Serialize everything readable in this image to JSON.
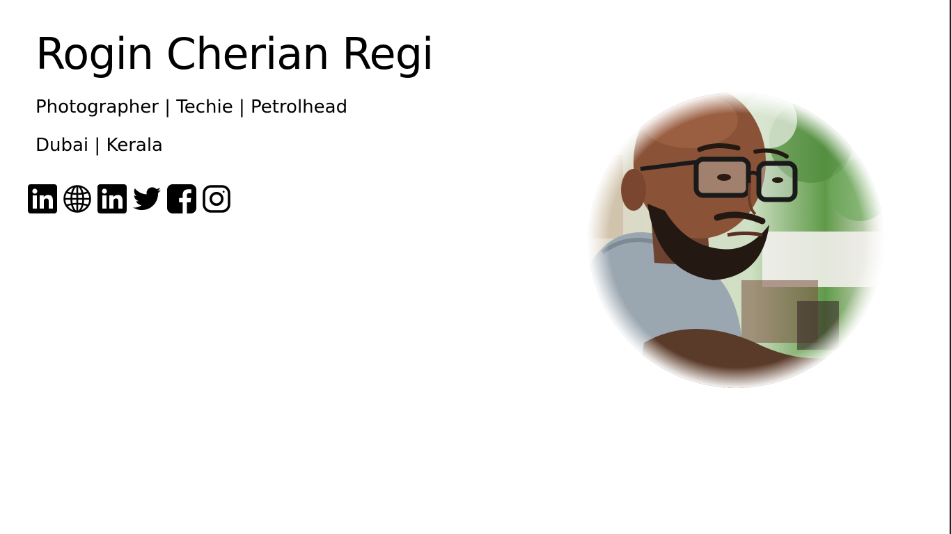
{
  "profile": {
    "name": "Rogin Cherian Regi",
    "tagline": "Photographer | Techie | Petrolhead",
    "location": "Dubai | Kerala"
  },
  "social_links": [
    {
      "icon": "linkedin-icon"
    },
    {
      "icon": "globe-icon"
    },
    {
      "icon": "linkedin-icon"
    },
    {
      "icon": "twitter-icon"
    },
    {
      "icon": "facebook-icon"
    },
    {
      "icon": "instagram-icon"
    }
  ],
  "photo": {
    "shape": "circle",
    "skin_color": "#8a5236",
    "shirt_color": "#9aa6b0",
    "background_colors": [
      "#d8e8d0",
      "#5f9a48",
      "#e8e4dc"
    ]
  },
  "colors": {
    "background": "#ffffff",
    "text": "#000000"
  }
}
